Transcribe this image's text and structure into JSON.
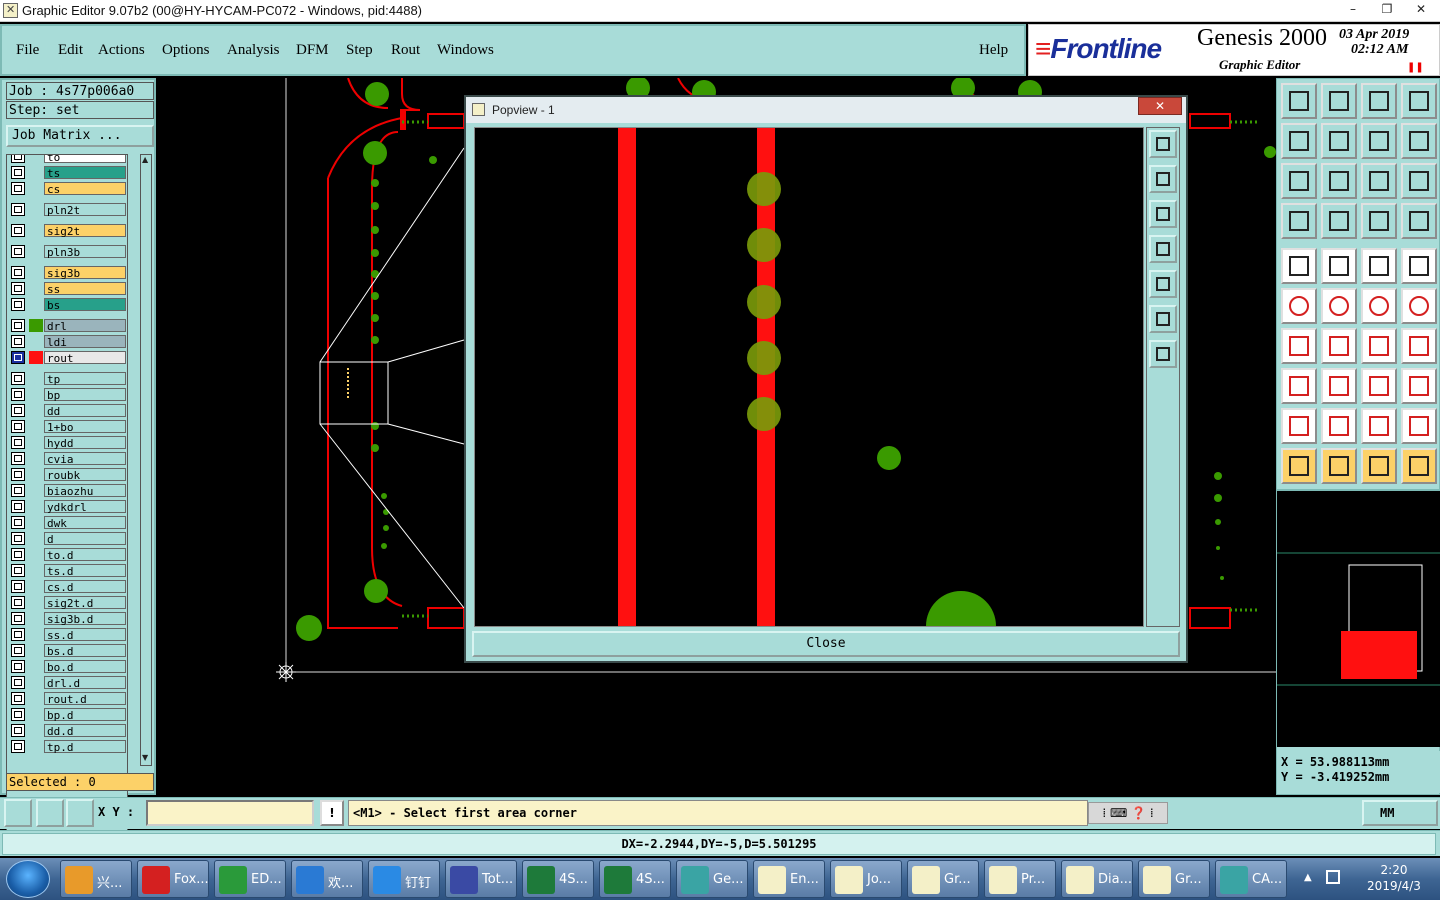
{
  "window": {
    "title": "Graphic Editor 9.07b2 (00@HY-HYCAM-PC072 - Windows, pid:4488)",
    "controls": [
      "–",
      "❐",
      "✕"
    ]
  },
  "menu": {
    "items": [
      "File",
      "Edit",
      "Actions",
      "Options",
      "Analysis",
      "DFM",
      "Step",
      "Rout",
      "Windows"
    ],
    "help": "Help"
  },
  "brand": {
    "logo": "Frontline",
    "product": "Genesis 2000",
    "subtitle": "Graphic Editor",
    "date": "03 Apr 2019",
    "time": "02:12 AM"
  },
  "job": {
    "job_line": "Job : 4s77p006a0",
    "step_line": "Step: set",
    "matrix_button": "Job Matrix ...",
    "selected": "Selected : 0"
  },
  "layers": [
    {
      "name": "to",
      "color": "#ffffff"
    },
    {
      "name": "ts",
      "color": "#27a08a"
    },
    {
      "name": "cs",
      "color": "#fcd168"
    },
    {
      "name": "pln2t",
      "color": "#a8dcd8"
    },
    {
      "name": "sig2t",
      "color": "#fcd168"
    },
    {
      "name": "pln3b",
      "color": "#a8dcd8"
    },
    {
      "name": "sig3b",
      "color": "#fcd168"
    },
    {
      "name": "ss",
      "color": "#fcd168"
    },
    {
      "name": "bs",
      "color": "#27a08a"
    },
    {
      "name": "drl",
      "color": "#9ab4bc"
    },
    {
      "name": "ldi",
      "color": "#9ab4bc"
    },
    {
      "name": "rout",
      "color": "#e8e8e8"
    },
    {
      "name": "tp",
      "color": "#a8dcd8"
    },
    {
      "name": "bp",
      "color": "#a8dcd8"
    },
    {
      "name": "dd",
      "color": "#a8dcd8"
    },
    {
      "name": "1+bo",
      "color": "#a8dcd8"
    },
    {
      "name": "hydd",
      "color": "#a8dcd8"
    },
    {
      "name": "cvia",
      "color": "#a8dcd8"
    },
    {
      "name": "roubk",
      "color": "#a8dcd8"
    },
    {
      "name": "biaozhu",
      "color": "#a8dcd8"
    },
    {
      "name": "ydkdrl",
      "color": "#a8dcd8"
    },
    {
      "name": "dwk",
      "color": "#a8dcd8"
    },
    {
      "name": "d",
      "color": "#a8dcd8"
    },
    {
      "name": "to.d",
      "color": "#a8dcd8"
    },
    {
      "name": "ts.d",
      "color": "#a8dcd8"
    },
    {
      "name": "cs.d",
      "color": "#a8dcd8"
    },
    {
      "name": "sig2t.d",
      "color": "#a8dcd8"
    },
    {
      "name": "sig3b.d",
      "color": "#a8dcd8"
    },
    {
      "name": "ss.d",
      "color": "#a8dcd8"
    },
    {
      "name": "bs.d",
      "color": "#a8dcd8"
    },
    {
      "name": "bo.d",
      "color": "#a8dcd8"
    },
    {
      "name": "drl.d",
      "color": "#a8dcd8"
    },
    {
      "name": "rout.d",
      "color": "#a8dcd8"
    },
    {
      "name": "bp.d",
      "color": "#a8dcd8"
    },
    {
      "name": "dd.d",
      "color": "#a8dcd8"
    },
    {
      "name": "tp.d",
      "color": "#a8dcd8"
    }
  ],
  "popview": {
    "title": "Popview - 1",
    "close": "Close",
    "close_x": "✕"
  },
  "command": {
    "xy_label": "X Y :",
    "xy_value": "",
    "excl": "!",
    "prompt": "<M1> - Select first area corner",
    "unit": "MM"
  },
  "coords": {
    "x": "X  =  53.988113mm",
    "y": "Y  =  -3.419252mm"
  },
  "status": {
    "text": "DX=-2.2944,DY=-5,D=5.501295"
  },
  "taskbar": {
    "items": [
      {
        "label": "兴...",
        "icon": "shell-icon",
        "color": "#e89a2a"
      },
      {
        "label": "Fox...",
        "icon": "foxit-icon",
        "color": "#d42020"
      },
      {
        "label": "ED...",
        "icon": "editor-icon",
        "color": "#2a9a3a"
      },
      {
        "label": "欢...",
        "icon": "ie-icon",
        "color": "#2a7ad4"
      },
      {
        "label": "钉钉",
        "icon": "dingtalk-icon",
        "color": "#2a8ae4"
      },
      {
        "label": "Tot...",
        "icon": "save-icon",
        "color": "#3a4aa4"
      },
      {
        "label": "4S...",
        "icon": "excel-icon",
        "color": "#1e7a3a"
      },
      {
        "label": "4S...",
        "icon": "excel-icon",
        "color": "#1e7a3a"
      },
      {
        "label": "Ge...",
        "icon": "genesis-icon",
        "color": "#3aa4a4"
      },
      {
        "label": "En...",
        "icon": "x-window-icon",
        "color": "#f4f0c8"
      },
      {
        "label": "Jo...",
        "icon": "x-window-icon",
        "color": "#f4f0c8"
      },
      {
        "label": "Gr...",
        "icon": "x-window-icon",
        "color": "#f4f0c8"
      },
      {
        "label": "Pr...",
        "icon": "x-window-icon",
        "color": "#f4f0c8"
      },
      {
        "label": "Dia...",
        "icon": "x-window-icon",
        "color": "#f4f0c8"
      },
      {
        "label": "Gr...",
        "icon": "x-window-icon",
        "color": "#f4f0c8"
      },
      {
        "label": "CA...",
        "icon": "cam-icon",
        "color": "#3aa4a4"
      }
    ],
    "clock_time": "2:20",
    "clock_date": "2019/4/3"
  },
  "colors": {
    "panel": "#a8dcd8",
    "accent_yellow": "#fcd168",
    "pcb_red": "#ff1010",
    "pcb_green": "#3a9a00"
  }
}
